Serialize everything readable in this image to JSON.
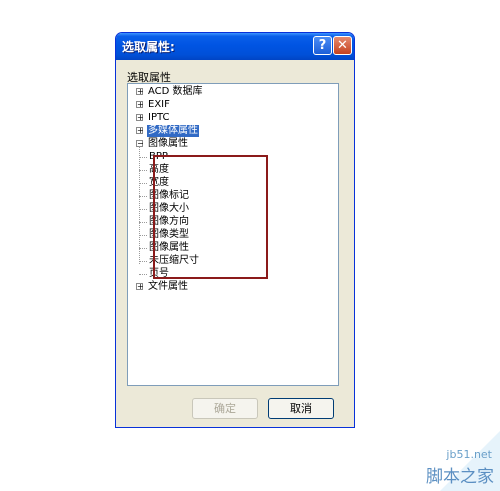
{
  "dialog": {
    "title": "选取属性:",
    "help_glyph": "?",
    "close_glyph": "✕",
    "group_label": "选取属性"
  },
  "tree": [
    {
      "label": "ACD 数据库",
      "expander": "+"
    },
    {
      "label": "EXIF",
      "expander": "+"
    },
    {
      "label": "IPTC",
      "expander": "+"
    },
    {
      "label": "多媒体属性",
      "expander": "+",
      "selected": true
    },
    {
      "label": "图像属性",
      "expander": "−"
    },
    {
      "label": "BPP"
    },
    {
      "label": "高度"
    },
    {
      "label": "宽度"
    },
    {
      "label": "图像标记"
    },
    {
      "label": "图像大小"
    },
    {
      "label": "图像方向"
    },
    {
      "label": "图像类型"
    },
    {
      "label": "图像属性"
    },
    {
      "label": "未压缩尺寸"
    },
    {
      "label": "页号"
    },
    {
      "label": "文件属性",
      "expander": "+"
    }
  ],
  "buttons": {
    "ok": "确定",
    "cancel": "取消"
  },
  "watermark": {
    "site": "jb51.net",
    "name": "脚本之家"
  },
  "colors": {
    "titlebar": "#0054e3",
    "highlight_box": "#8b1a1a",
    "selection": "#316ac5"
  }
}
